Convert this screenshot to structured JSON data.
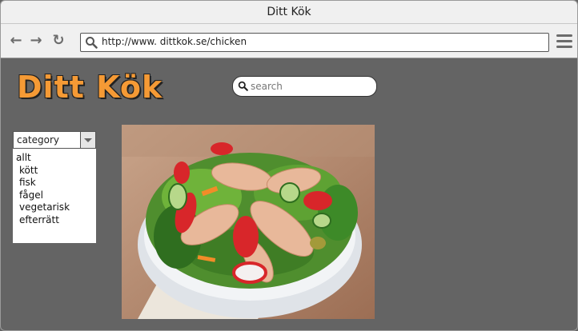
{
  "window": {
    "title": "Ditt Kök"
  },
  "toolbar": {
    "url": "http://www. dittkok.se/chicken"
  },
  "site": {
    "logo": "Ditt Kök",
    "search_placeholder": "search",
    "category": {
      "selected": "category",
      "options": [
        "allt",
        "kött",
        "fisk",
        "fågel",
        "vegetarisk",
        "efterrätt"
      ]
    }
  },
  "icons": {
    "back": "back-arrow-icon",
    "forward": "forward-arrow-icon",
    "reload": "reload-icon",
    "menu": "hamburger-menu-icon",
    "search": "search-icon"
  },
  "colors": {
    "logo": "#f59a35",
    "page_background": "#646464",
    "chrome": "#f0f0f0"
  }
}
